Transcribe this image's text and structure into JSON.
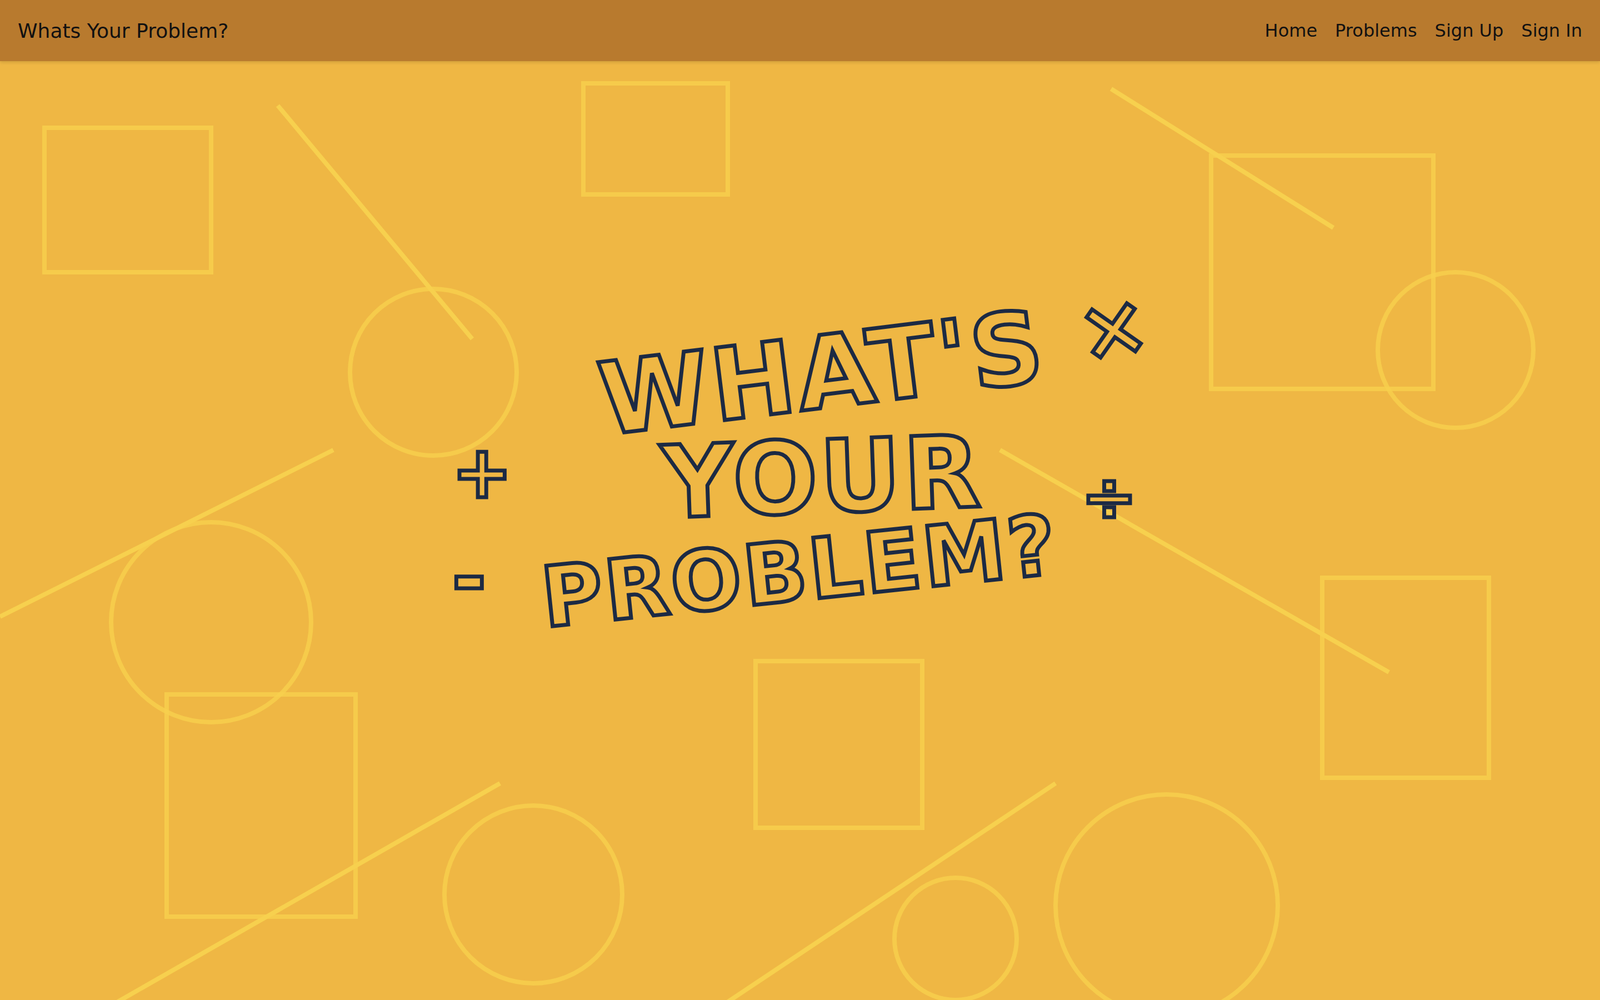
{
  "navbar": {
    "brand": "Whats Your Problem?",
    "links": [
      {
        "label": "Home"
      },
      {
        "label": "Problems"
      },
      {
        "label": "Sign Up"
      },
      {
        "label": "Sign In"
      }
    ]
  },
  "hero": {
    "logo_lines": [
      "WHAT'S",
      "YOUR",
      "PROBLEM?"
    ],
    "symbols": [
      "+",
      "-",
      "×",
      "÷"
    ]
  }
}
